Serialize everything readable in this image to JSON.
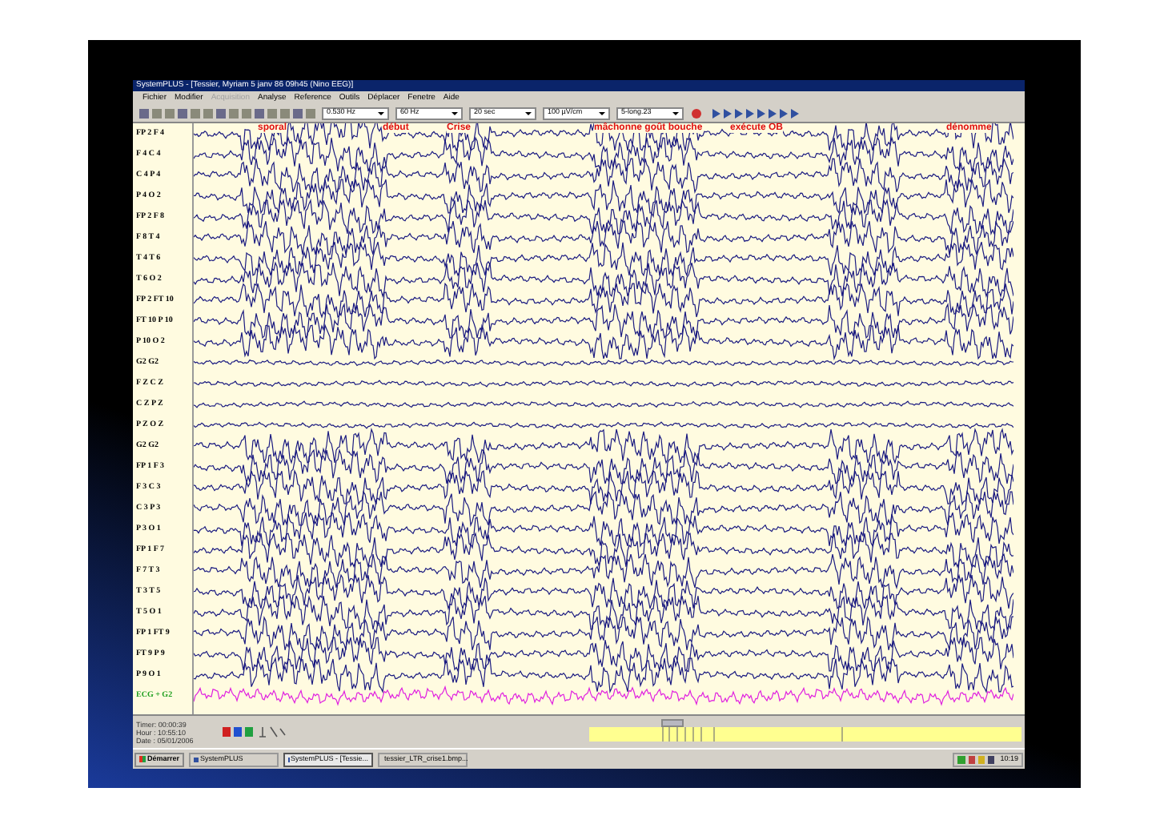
{
  "window": {
    "title": "SystemPLUS - [Tessier, Myriam 5 janv 86 09h45 (Nino EEG)]"
  },
  "menu": [
    {
      "label": "Fichier",
      "disabled": false
    },
    {
      "label": "Modifier",
      "disabled": false
    },
    {
      "label": "Acquisition",
      "disabled": true
    },
    {
      "label": "Analyse",
      "disabled": false
    },
    {
      "label": "Reference",
      "disabled": false
    },
    {
      "label": "Outils",
      "disabled": false
    },
    {
      "label": "Déplacer",
      "disabled": false
    },
    {
      "label": "Fenetre",
      "disabled": false
    },
    {
      "label": "Aide",
      "disabled": false
    }
  ],
  "toolbar": {
    "dropdowns": [
      "0.530 Hz",
      "60 Hz",
      "20 sec",
      "100 µV/cm",
      "5-long.23"
    ]
  },
  "annotations": [
    "sporal",
    "début",
    "Crise",
    "mâchonne goût bouche",
    "exécute OB",
    "dénomme"
  ],
  "channels": [
    {
      "name": "FP 2 F 4",
      "kind": "eeg"
    },
    {
      "name": "F 4 C 4",
      "kind": "eeg"
    },
    {
      "name": "C 4 P 4",
      "kind": "eeg"
    },
    {
      "name": "P 4 O 2",
      "kind": "eeg"
    },
    {
      "name": "FP 2 F 8",
      "kind": "eeg"
    },
    {
      "name": "F 8 T 4",
      "kind": "eeg"
    },
    {
      "name": "T 4 T 6",
      "kind": "eeg"
    },
    {
      "name": "T 6 O 2",
      "kind": "eeg"
    },
    {
      "name": "FP 2 FT 10",
      "kind": "eeg"
    },
    {
      "name": "FT 10 P 10",
      "kind": "eeg"
    },
    {
      "name": "P 10 O 2",
      "kind": "eeg"
    },
    {
      "name": "G2 G2",
      "kind": "flat"
    },
    {
      "name": "F Z C Z",
      "kind": "flat"
    },
    {
      "name": "C Z P Z",
      "kind": "flat"
    },
    {
      "name": "P Z O Z",
      "kind": "flat"
    },
    {
      "name": "G2 G2",
      "kind": "eeg"
    },
    {
      "name": "FP 1 F 3",
      "kind": "eeg"
    },
    {
      "name": "F 3 C 3",
      "kind": "eeg"
    },
    {
      "name": "C 3 P 3",
      "kind": "eeg"
    },
    {
      "name": "P 3 O 1",
      "kind": "eeg"
    },
    {
      "name": "FP 1 F 7",
      "kind": "eeg"
    },
    {
      "name": "F 7 T 3",
      "kind": "eeg"
    },
    {
      "name": "T 3 T 5",
      "kind": "eeg"
    },
    {
      "name": "T 5 O 1",
      "kind": "eeg"
    },
    {
      "name": "FP 1 FT 9",
      "kind": "eeg"
    },
    {
      "name": "FT 9 P 9",
      "kind": "eeg"
    },
    {
      "name": "P 9 O 1",
      "kind": "eeg"
    },
    {
      "name": "ECG + G2",
      "kind": "ecg"
    }
  ],
  "status": [
    "Timer: 00:00:39",
    "Hour : 10:55:10",
    "Date : 05/01/2006"
  ],
  "taskbar": {
    "start": "Démarrer",
    "tasks": [
      {
        "label": "SystemPLUS",
        "selected": false
      },
      {
        "label": "SystemPLUS - [Tessie...",
        "selected": true
      },
      {
        "label": "tessier_LTR_crise1.bmp...",
        "selected": false
      }
    ],
    "clock": "10:19"
  }
}
